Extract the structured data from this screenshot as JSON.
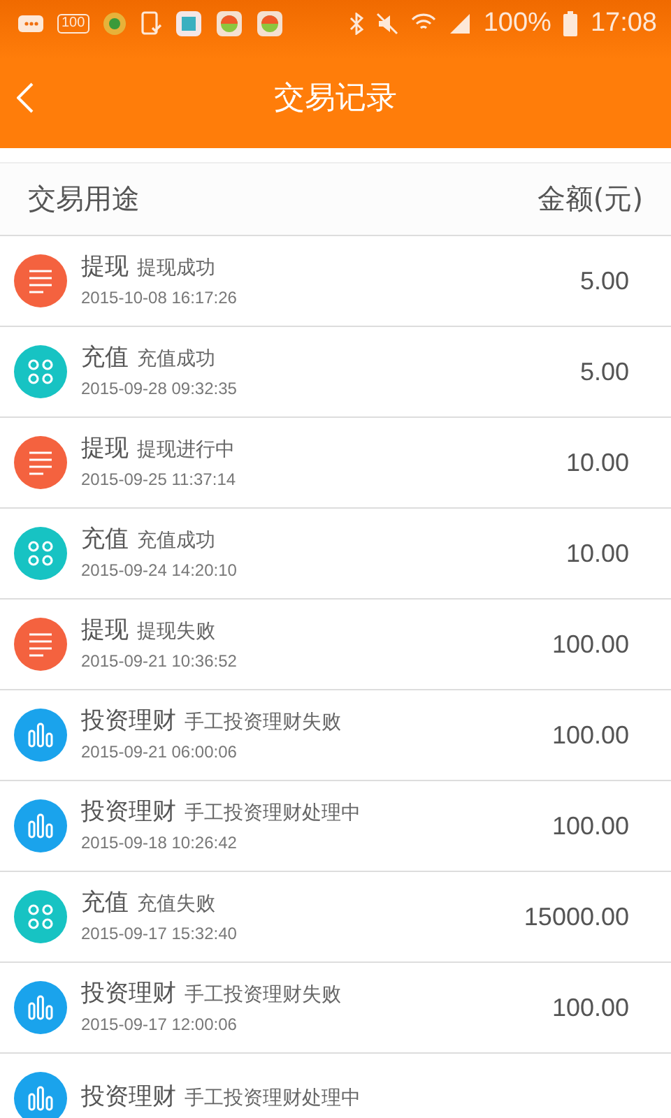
{
  "status_bar": {
    "badge": "100",
    "battery": "100%",
    "time": "17:08"
  },
  "header": {
    "title": "交易记录"
  },
  "columns": [
    "交易用途",
    "金额(元)"
  ],
  "rows": [
    {
      "kind": "withdraw",
      "type": "提现",
      "status": "提现成功",
      "time": "2015-10-08 16:17:26",
      "amount": "5.00"
    },
    {
      "kind": "recharge",
      "type": "充值",
      "status": "充值成功",
      "time": "2015-09-28 09:32:35",
      "amount": "5.00"
    },
    {
      "kind": "withdraw",
      "type": "提现",
      "status": "提现进行中",
      "time": "2015-09-25 11:37:14",
      "amount": "10.00"
    },
    {
      "kind": "recharge",
      "type": "充值",
      "status": "充值成功",
      "time": "2015-09-24 14:20:10",
      "amount": "10.00"
    },
    {
      "kind": "withdraw",
      "type": "提现",
      "status": "提现失败",
      "time": "2015-09-21 10:36:52",
      "amount": "100.00"
    },
    {
      "kind": "invest",
      "type": "投资理财",
      "status": "手工投资理财失败",
      "time": "2015-09-21 06:00:06",
      "amount": "100.00"
    },
    {
      "kind": "invest",
      "type": "投资理财",
      "status": "手工投资理财处理中",
      "time": "2015-09-18 10:26:42",
      "amount": "100.00"
    },
    {
      "kind": "recharge",
      "type": "充值",
      "status": "充值失败",
      "time": "2015-09-17 15:32:40",
      "amount": "15000.00"
    },
    {
      "kind": "invest",
      "type": "投资理财",
      "status": "手工投资理财失败",
      "time": "2015-09-17 12:00:06",
      "amount": "100.00"
    },
    {
      "kind": "invest",
      "type": "投资理财",
      "status": "手工投资理财处理中"
    }
  ]
}
